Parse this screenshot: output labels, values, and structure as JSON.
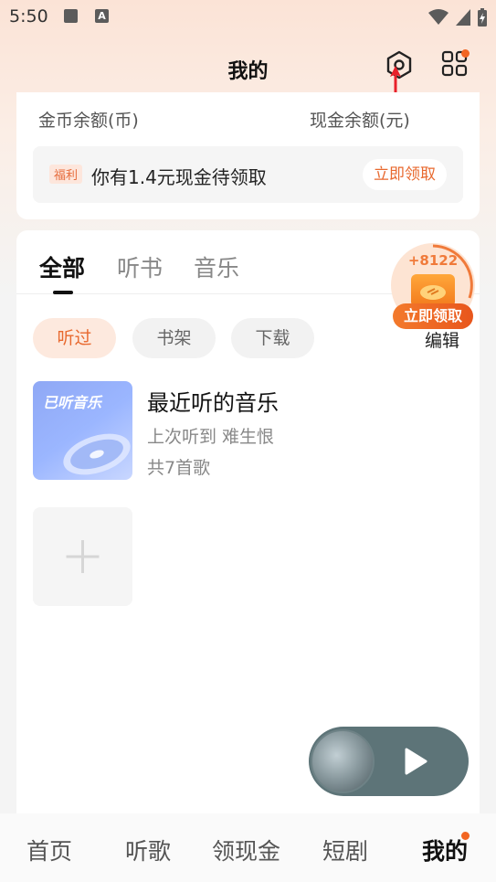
{
  "status_bar": {
    "time": "5:50",
    "icons": [
      "stop-square-icon",
      "a-badge-icon",
      "wifi-icon",
      "signal-icon",
      "battery-charging-icon"
    ],
    "a_badge": "A"
  },
  "header": {
    "title": "我的",
    "icons": [
      "settings-hex-icon",
      "apps-grid-icon"
    ],
    "notification_dot_color": "#f26522"
  },
  "balance": {
    "coin_label": "金币余额(币)",
    "cash_label": "现金余额(元)"
  },
  "welfare": {
    "tag": "福利",
    "text": "你有1.4元现金待领取",
    "button": "立即领取"
  },
  "tabs": [
    {
      "label": "全部",
      "active": true
    },
    {
      "label": "听书",
      "active": false
    },
    {
      "label": "音乐",
      "active": false
    }
  ],
  "filters": [
    {
      "label": "听过",
      "active": true
    },
    {
      "label": "书架",
      "active": false
    },
    {
      "label": "下载",
      "active": false
    }
  ],
  "edit_label": "编辑",
  "recent": {
    "cover_label": "已听音乐",
    "title": "最近听的音乐",
    "last_played": "上次听到 难生恨",
    "count": "共7首歌"
  },
  "reward": {
    "amount": "+8122",
    "button": "立即领取"
  },
  "bottom_nav": [
    {
      "label": "首页",
      "active": false
    },
    {
      "label": "听歌",
      "active": false
    },
    {
      "label": "领现金",
      "active": false
    },
    {
      "label": "短剧",
      "active": false
    },
    {
      "label": "我的",
      "active": true
    }
  ],
  "colors": {
    "accent": "#e8692f",
    "chip_active_bg": "#fde9de",
    "player_bg": "#5d7478"
  }
}
